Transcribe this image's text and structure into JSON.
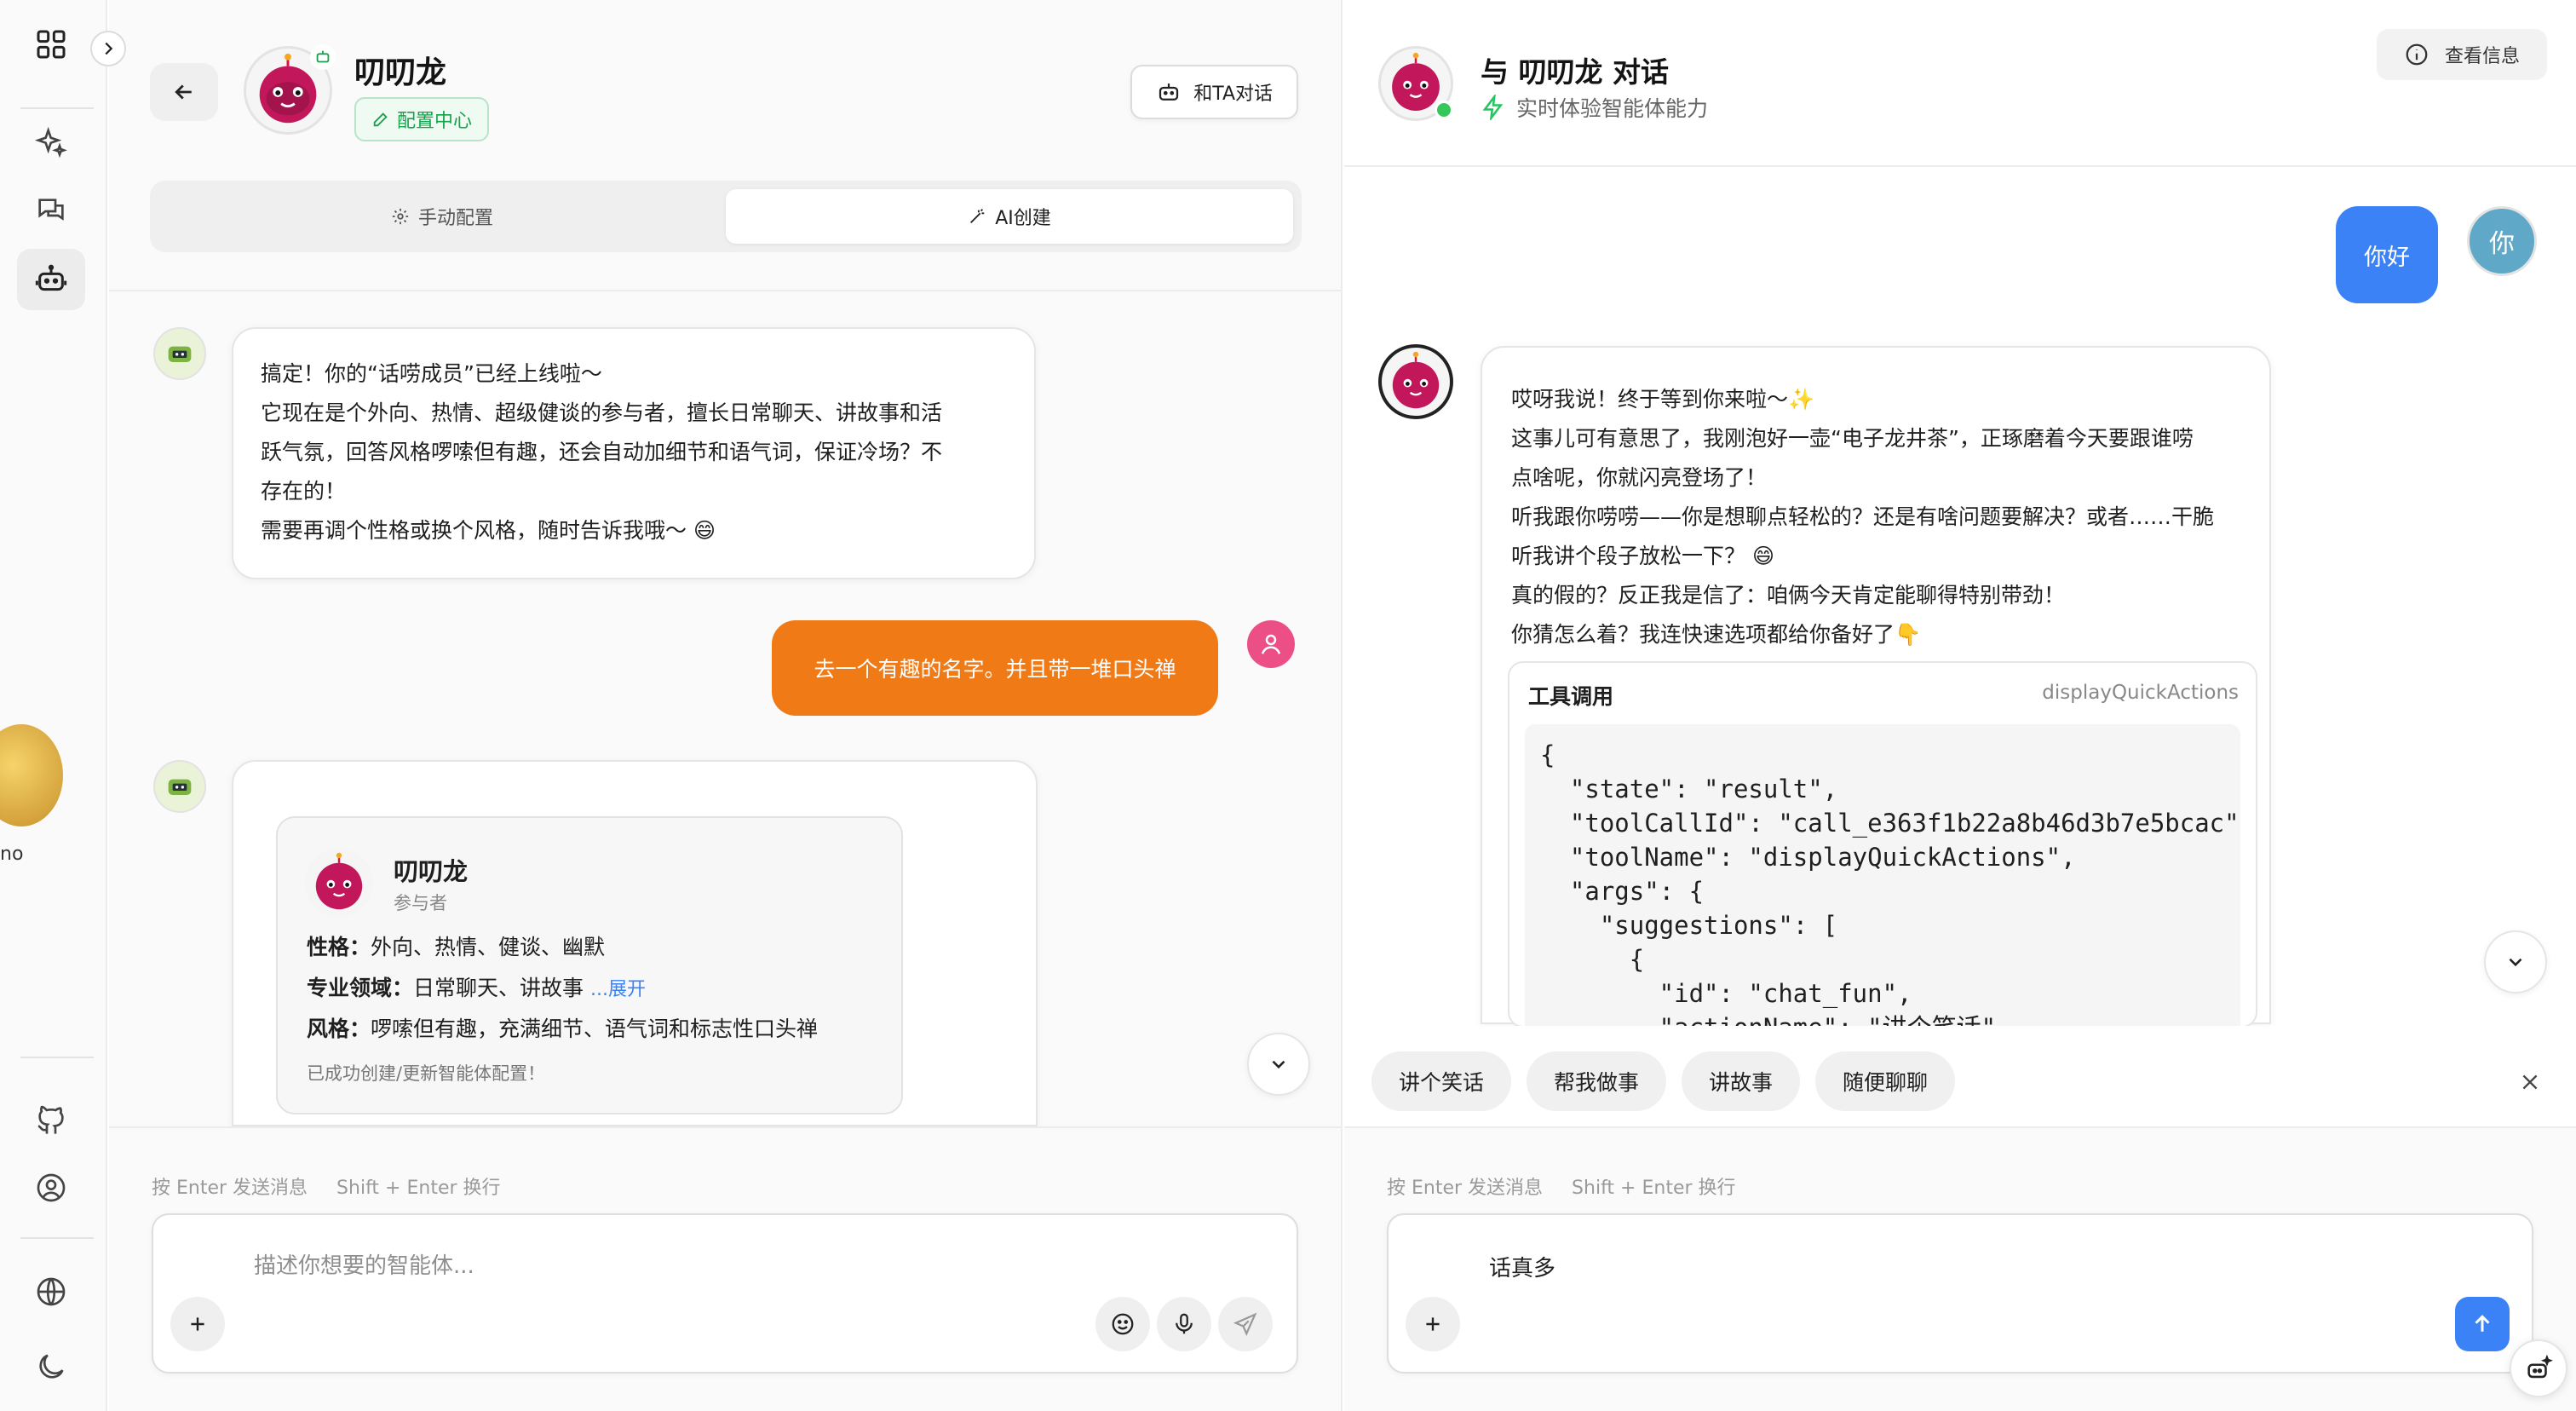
{
  "colors": {
    "accent_orange": "#f07a16",
    "accent_blue": "#3b82f6",
    "success_green": "#16a34a",
    "pink": "#ec4f86"
  },
  "floating": {
    "label": "no"
  },
  "left": {
    "agent_name": "叨叨龙",
    "config_badge": "配置中心",
    "chat_with_btn": "和TA对话",
    "tabs": [
      {
        "label": "手动配置"
      },
      {
        "label": "AI创建"
      }
    ],
    "messages": {
      "bot1": [
        "搞定！你的“话唠成员”已经上线啦～",
        "它现在是个外向、热情、超级健谈的参与者，擅长日常聊天、讲故事和活",
        "跃气氛，回答风格啰嗦但有趣，还会自动加细节和语气词，保证冷场？不",
        "存在的！",
        "需要再调个性格或换个风格，随时告诉我哦～ 😄"
      ],
      "user1": "去一个有趣的名字。并且带一堆口头禅",
      "card": {
        "name": "叨叨龙",
        "role": "参与者",
        "personality_label": "性格：",
        "personality": "外向、热情、健谈、幽默",
        "domain_label": "专业领域：",
        "domain": "日常聊天、讲故事",
        "expand": "...展开",
        "style_label": "风格：",
        "style": "啰嗦但有趣，充满细节、语气词和标志性口头禅",
        "status": "已成功创建/更新智能体配置！"
      }
    },
    "composer": {
      "hint_enter": "按 Enter 发送消息",
      "hint_shift": "Shift + Enter 换行",
      "placeholder": "描述你想要的智能体...",
      "value": ""
    }
  },
  "right": {
    "title": "与 叨叨龙 对话",
    "subtitle": "实时体验智能体能力",
    "info_btn": "查看信息",
    "user_avatar": "你",
    "user_msg": "你好",
    "bot_lines": [
      "哎呀我说！终于等到你来啦～✨",
      "这事儿可有意思了，我刚泡好一壶“电子龙井茶”，正琢磨着今天要跟谁唠",
      "点啥呢，你就闪亮登场了！",
      "听我跟你唠唠——你是想聊点轻松的？还是有啥问题要解决？或者……干脆",
      "听我讲个段子放松一下？ 😄",
      "真的假的？反正我是信了：咱俩今天肯定能聊得特别带劲！",
      "你猜怎么着？我连快速选项都给你备好了👇"
    ],
    "tool": {
      "title": "工具调用",
      "name": "displayQuickActions",
      "code": "{\n  \"state\": \"result\",\n  \"toolCallId\": \"call_e363f1b22a8b46d3b7e5bcac\",\n  \"toolName\": \"displayQuickActions\",\n  \"args\": {\n    \"suggestions\": [\n      {\n        \"id\": \"chat_fun\",\n        \"actionName\": \"讲个笑话\""
    },
    "quick_actions": [
      "讲个笑话",
      "帮我做事",
      "讲故事",
      "随便聊聊"
    ],
    "composer": {
      "hint_enter": "按 Enter 发送消息",
      "hint_shift": "Shift + Enter 换行",
      "value": "话真多"
    }
  }
}
